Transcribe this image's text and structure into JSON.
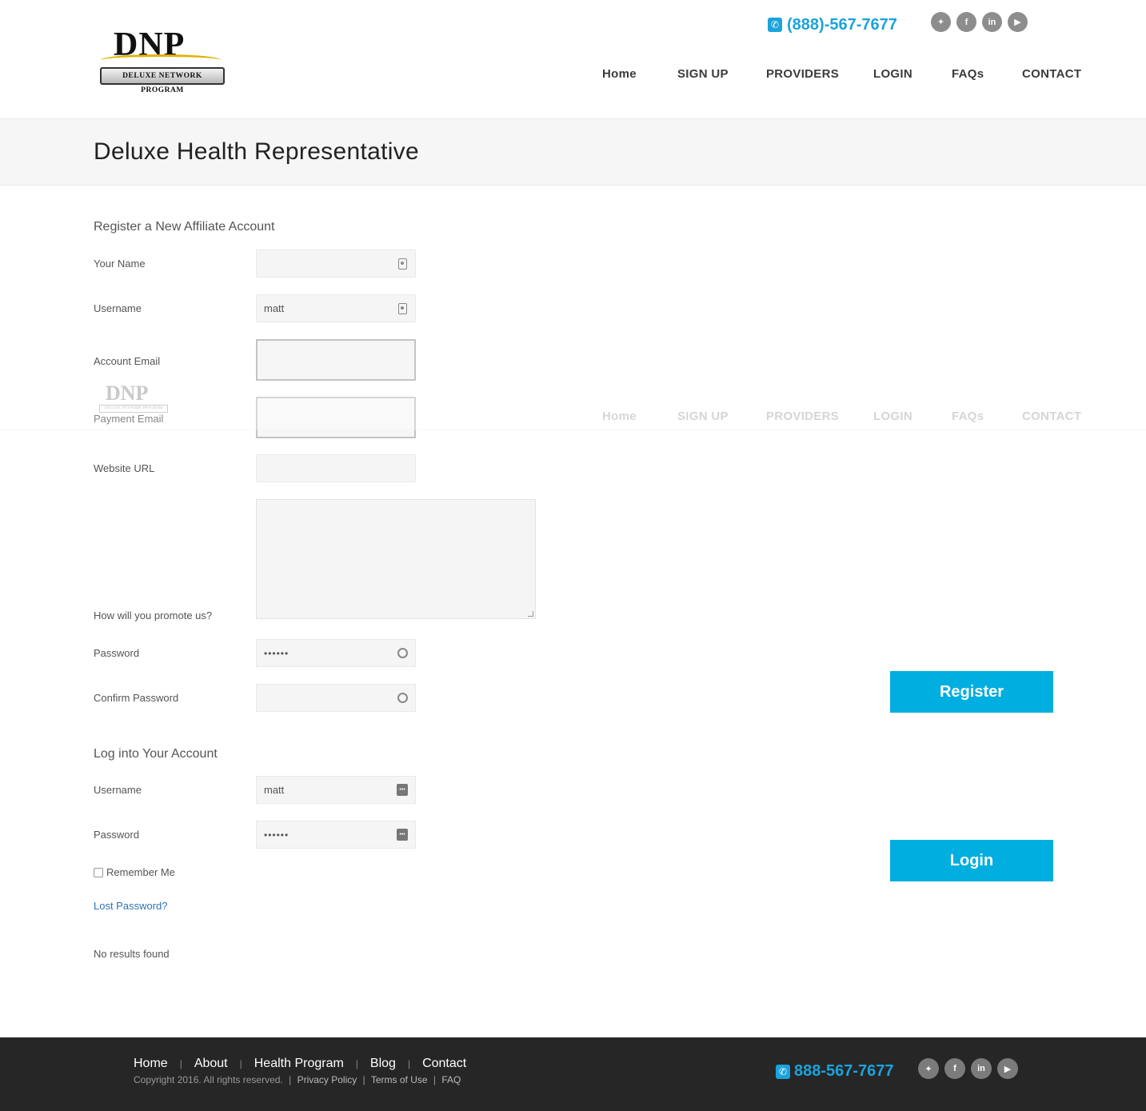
{
  "brand": {
    "logo_text": "DNP",
    "logo_subtext": "DELUXE NETWORK PROGRAM"
  },
  "header": {
    "phone": "(888)-567-7677",
    "social": [
      "twitter-icon",
      "facebook-icon",
      "linkedin-icon",
      "youtube-icon"
    ],
    "nav": [
      "Home",
      "SIGN UP",
      "PROVIDERS",
      "LOGIN",
      "FAQs",
      "CONTACT"
    ]
  },
  "page": {
    "title": "Deluxe Health Representative"
  },
  "register": {
    "heading": "Register a New Affiliate Account",
    "labels": {
      "name": "Your Name",
      "username": "Username",
      "account_email": "Account Email",
      "payment_email": "Payment Email",
      "website": "Website URL",
      "promote": "How will you promote us?",
      "password": "Password",
      "confirm_password": "Confirm Password"
    },
    "values": {
      "name": "",
      "username": "matt",
      "account_email": "",
      "payment_email": "",
      "website": "",
      "promote": "",
      "password": "••••••",
      "confirm_password": ""
    },
    "button": "Register"
  },
  "login": {
    "heading": "Log into Your Account",
    "labels": {
      "username": "Username",
      "password": "Password"
    },
    "values": {
      "username": "matt",
      "password": "••••••"
    },
    "remember": "Remember Me",
    "lost_password": "Lost Password?",
    "button": "Login"
  },
  "results": {
    "text": "No results found"
  },
  "colors": {
    "accent": "#00aedf",
    "phone": "#1aa3dc",
    "footer_bg": "#262626"
  },
  "footer": {
    "links": [
      "Home",
      "About",
      "Health Program",
      "Blog",
      "Contact"
    ],
    "copyright": "Copyright 2016. All rights reserved.",
    "legal": [
      "Privacy Policy",
      "Terms of Use",
      "FAQ"
    ],
    "phone": "888-567-7677",
    "social": [
      "twitter-icon",
      "facebook-icon",
      "linkedin-icon",
      "youtube-icon"
    ]
  }
}
